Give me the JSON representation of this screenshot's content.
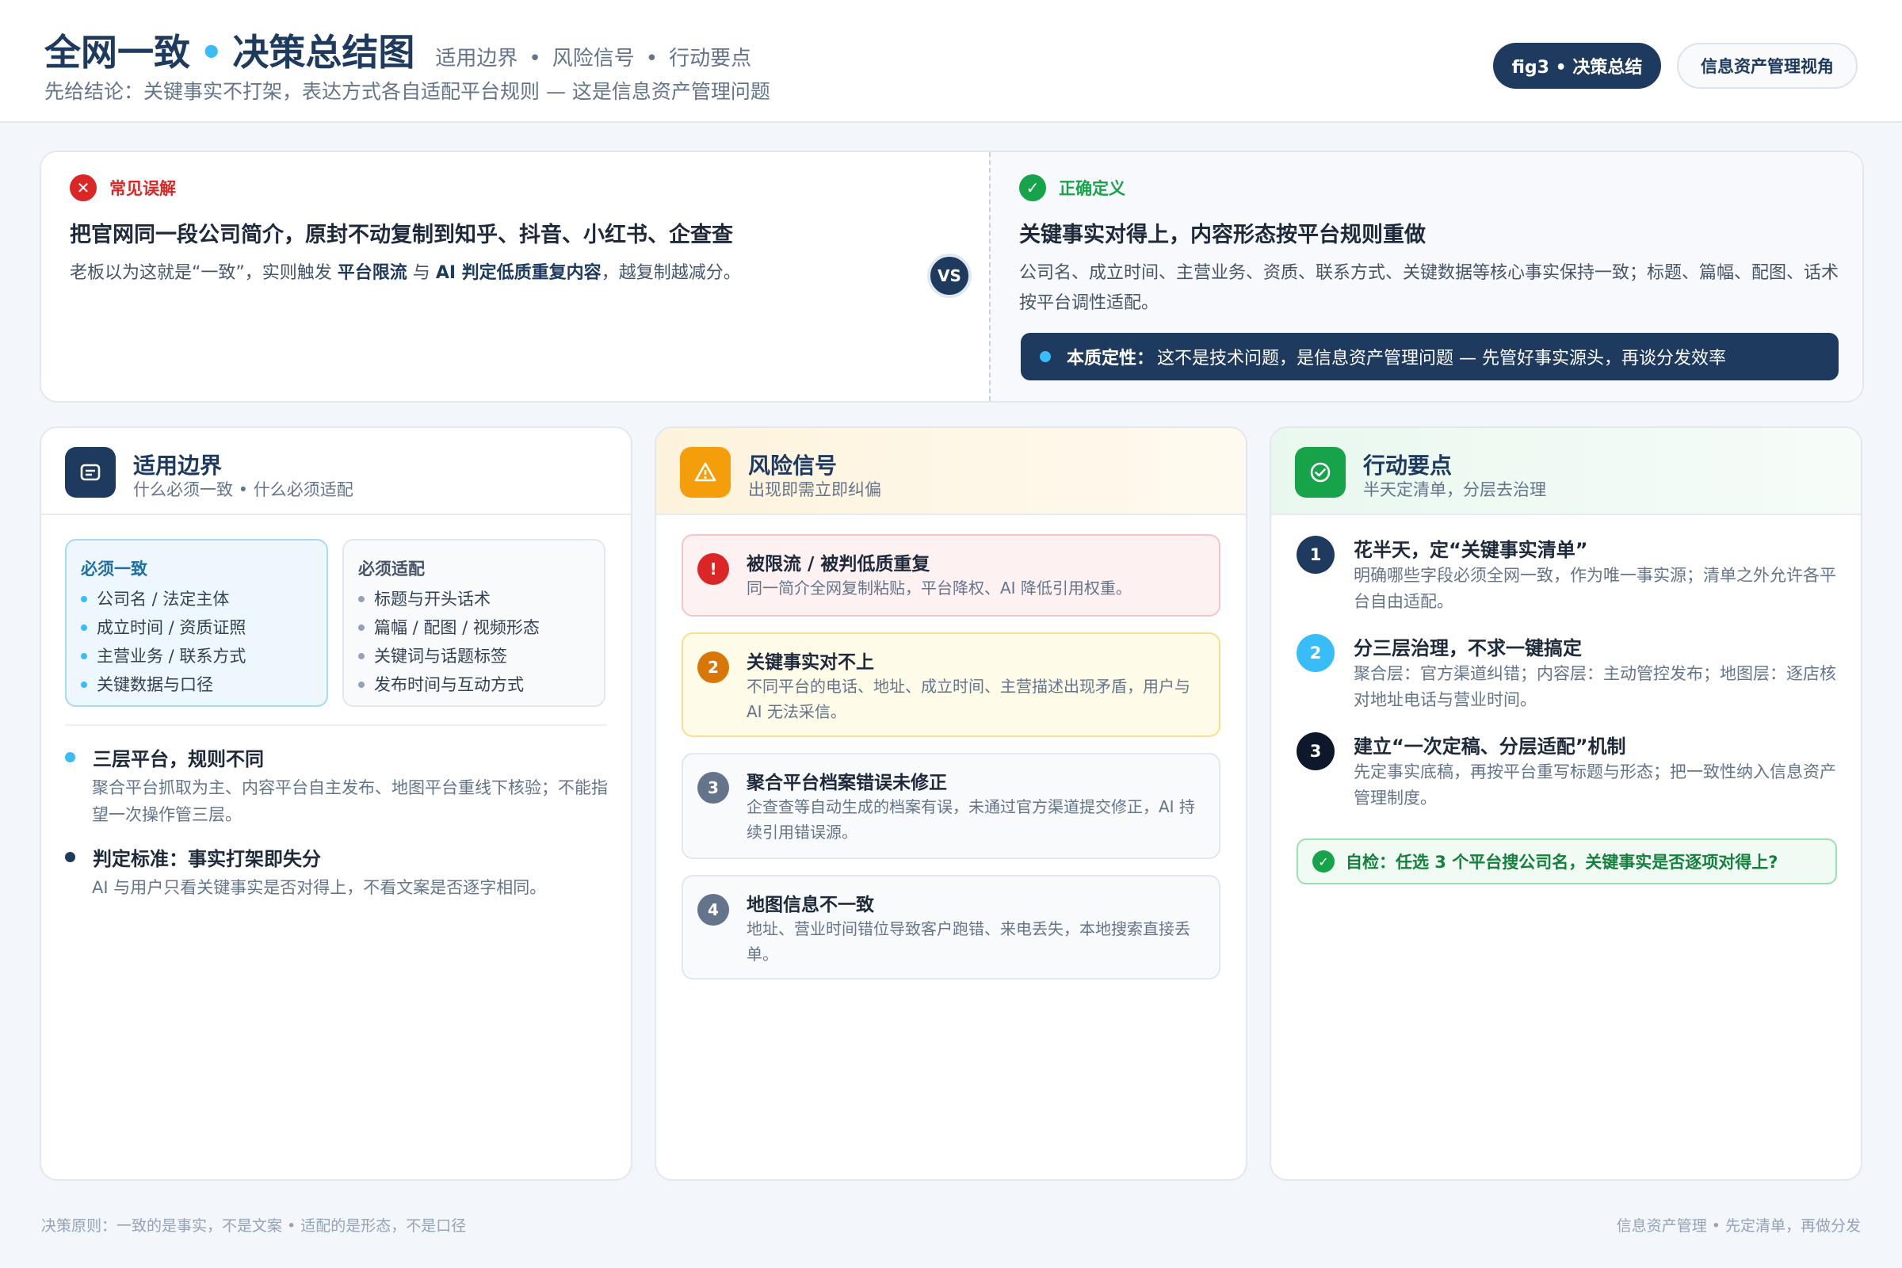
{
  "header": {
    "title_part1": "全网一致",
    "title_sep": "•",
    "title_part2": "决策总结图",
    "tags": [
      "适用边界",
      "风险信号",
      "行动要点"
    ],
    "tag_sep": "•",
    "subtitle": "先给结论：关键事实不打架，表达方式各自适配平台规则 — 这是信息资产管理问题",
    "pill_primary": "fig3 • 决策总结",
    "pill_secondary": "信息资产管理视角"
  },
  "compare": {
    "left": {
      "tag_icon": "✕",
      "tag": "常见误解",
      "headline": "把官网同一段公司简介，原封不动复制到知乎、抖音、小红书、企查查",
      "body_pre": "老板以为这就是“一致”，实则触发 ",
      "body_b1": "平台限流",
      "body_mid": " 与 ",
      "body_b2": "AI 判定低质重复内容",
      "body_post": "，越复制越减分。"
    },
    "vs": "VS",
    "right": {
      "tag_icon": "✓",
      "tag": "正确定义",
      "headline": "关键事实对得上，内容形态按平台规则重做",
      "body": "公司名、成立时间、主营业务、资质、联系方式、关键数据等核心事实保持一致；标题、篇幅、配图、话术按平台调性适配。",
      "essence_label": "本质定性：",
      "essence_text": "这不是技术问题，是信息资产管理问题 — 先管好事实源头，再谈分发效率"
    },
    "colors": {
      "error": "#dc2626",
      "success": "#16a34a",
      "navy": "#1e3a5f",
      "accent": "#38bdf8"
    }
  },
  "columns": {
    "boundary": {
      "icon": "document-list-icon",
      "title": "适用边界",
      "subtitle": "什么必须一致 • 什么必须适配",
      "must_consistent": {
        "title": "必须一致",
        "items": [
          "公司名 / 法定主体",
          "成立时间 / 资质证照",
          "主营业务 / 联系方式",
          "关键数据与口径"
        ]
      },
      "must_adapt": {
        "title": "必须适配",
        "items": [
          "标题与开头话术",
          "篇幅 / 配图 / 视频形态",
          "关键词与话题标签",
          "发布时间与互动方式"
        ]
      },
      "notes": [
        {
          "title": "三层平台，规则不同",
          "body": "聚合平台抓取为主、内容平台自主发布、地图平台重线下核验；不能指望一次操作管三层。"
        },
        {
          "title": "判定标准：事实打架即失分",
          "body": "AI 与用户只看关键事实是否对得上，不看文案是否逐字相同。"
        }
      ]
    },
    "risk": {
      "icon": "warning-icon",
      "title": "风险信号",
      "subtitle": "出现即需立即纠偏",
      "items": [
        {
          "num": "!",
          "title": "被限流 / 被判低质重复",
          "body": "同一简介全网复制粘贴，平台降权、AI 降低引用权重。"
        },
        {
          "num": "2",
          "title": "关键事实对不上",
          "body": "不同平台的电话、地址、成立时间、主营描述出现矛盾，用户与 AI 无法采信。"
        },
        {
          "num": "3",
          "title": "聚合平台档案错误未修正",
          "body": "企查查等自动生成的档案有误，未通过官方渠道提交修正，AI 持续引用错误源。"
        },
        {
          "num": "4",
          "title": "地图信息不一致",
          "body": "地址、营业时间错位导致客户跑错、来电丢失，本地搜索直接丢单。"
        }
      ]
    },
    "action": {
      "icon": "check-circle-icon",
      "title": "行动要点",
      "subtitle": "半天定清单，分层去治理",
      "steps": [
        {
          "num": "1",
          "title": "花半天，定“关键事实清单”",
          "body": "明确哪些字段必须全网一致，作为唯一事实源；清单之外允许各平台自由适配。"
        },
        {
          "num": "2",
          "title": "分三层治理，不求一键搞定",
          "body": "聚合层：官方渠道纠错；内容层：主动管控发布；地图层：逐店核对地址电话与营业时间。"
        },
        {
          "num": "3",
          "title": "建立“一次定稿、分层适配”机制",
          "body": "先定事实底稿，再按平台重写标题与形态；把一致性纳入信息资产管理制度。"
        }
      ],
      "check_icon": "✓",
      "check": "自检：任选 3 个平台搜公司名，关键事实是否逐项对得上?"
    }
  },
  "footer": {
    "left": "决策原则：一致的是事实，不是文案 • 适配的是形态，不是口径",
    "right": "信息资产管理 • 先定清单，再做分发"
  }
}
